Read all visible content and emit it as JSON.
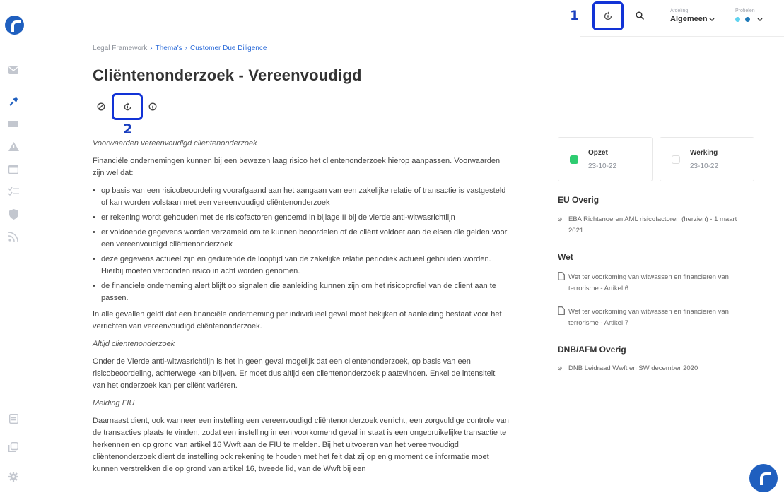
{
  "sidebar": {
    "icons": [
      "mail-icon",
      "pin-icon",
      "folder-icon",
      "warning-icon",
      "calendar-icon",
      "checklist-icon",
      "shield-icon",
      "feed-icon",
      "document-icon",
      "copy-icon",
      "settings-icon"
    ]
  },
  "topbar": {
    "callout_1": "1",
    "department_label": "Afdeling",
    "department_value": "Algemeen",
    "profiles_label": "Profielen"
  },
  "breadcrumb": {
    "root": "Legal Framework",
    "level1": "Thema's",
    "level2": "Customer Due Diligence"
  },
  "page": {
    "title": "Cliëntenonderzoek - Vereenvoudigd",
    "callout_2": "2"
  },
  "content": {
    "heading1": "Voorwaarden vereenvoudigd clientenonderzoek",
    "intro": "Financiële ondernemingen kunnen bij een bewezen laag risico het clientenonderzoek hierop aanpassen. Voorwaarden zijn wel dat:",
    "bullets": [
      "op basis van een risicobeoordeling voorafgaand aan het aangaan van een zakelijke relatie of transactie is vastgesteld of kan worden volstaan met een vereenvoudigd cliëntenonderzoek",
      "er rekening wordt gehouden met de risicofactoren genoemd in bijlage II bij de vierde anti-witwasrichtlijn",
      "er voldoende gegevens worden verzameld om te kunnen beoordelen of de cliënt voldoet aan de eisen die gelden voor een vereenvoudigd cliëntenonderzoek",
      "deze gegevens actueel zijn en gedurende de looptijd van de zakelijke relatie periodiek actueel gehouden worden. Hierbij moeten verbonden risico in acht worden genomen.",
      "de financiele onderneming alert blijft op signalen die aanleiding kunnen zijn om het risicoprofiel van de client aan te passen."
    ],
    "para2": "In alle gevallen geldt dat een financiële onderneming per individueel geval moet bekijken of aanleiding bestaat voor het verrichten van vereenvoudigd cliëntenonderzoek.",
    "heading2": "Altijd clientenonderzoek",
    "para3": "Onder de Vierde anti-witwasrichtlijn is het in geen geval mogelijk dat een clientenonderzoek, op basis van een risicobeoordeling, achterwege kan blijven. Er moet dus altijd een clientenonderzoek plaatsvinden. Enkel de intensiteit van het onderzoek kan per cliënt variëren.",
    "heading3": "Melding FIU",
    "para4": "Daarnaast dient, ook wanneer een instelling een vereenvoudigd cliëntenonderzoek verricht, een zorgvuldige controle van de transacties plaats te vinden, zodat een instelling in een voorkomend geval in staat is een ongebruikelijke transactie te herkennen en op grond van artikel 16 Wwft aan de FIU te melden. Bij het uitvoeren van het vereenvoudigd cliëntenonderzoek dient de instelling ook rekening te houden met het feit dat zij op enig moment de informatie moet kunnen verstrekken die op grond van artikel 16, tweede lid, van de Wwft bij een"
  },
  "status_cards": [
    {
      "title": "Opzet",
      "date": "23-10-22",
      "color": "#2ecc71"
    },
    {
      "title": "Werking",
      "date": "23-10-22",
      "color": "#ffffff"
    }
  ],
  "references": {
    "eu_heading": "EU Overig",
    "eu_items": [
      "EBA Richtsnoeren AML risicofactoren (herzien) - 1 maart 2021"
    ],
    "wet_heading": "Wet",
    "wet_items": [
      "Wet ter voorkoming van witwassen en financieren van terrorisme - Artikel 6",
      "Wet ter voorkoming van witwassen en financieren van terrorisme - Artikel 7"
    ],
    "dnb_heading": "DNB/AFM Overig",
    "dnb_items": [
      "DNB Leidraad Wwft en SW december 2020"
    ]
  },
  "colors": {
    "accent": "#1f5fbf",
    "callout": "#1233d6",
    "profile_dot_1": "#5fd3f0",
    "profile_dot_2": "#1f7ab8"
  }
}
